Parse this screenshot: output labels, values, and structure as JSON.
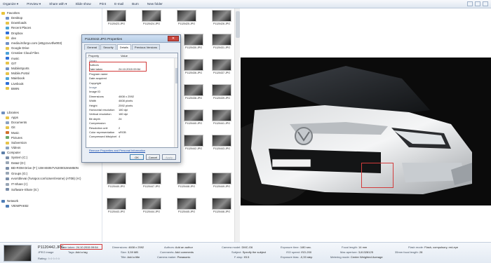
{
  "toolbar": {
    "organize": "Organize ▾",
    "preview": "Preview ▾",
    "share_with": "Share with ▾",
    "slide_show": "Slide show",
    "print": "Print",
    "email": "E-mail",
    "burn": "Burn",
    "new_folder": "New folder"
  },
  "nav": {
    "favorites_header": "Favorites",
    "favorites": [
      "Desktop",
      "Downloads",
      "Recent Places",
      "Dropbox",
      "dev",
      "media.itsforgo.com (eByp1vv4fw003)",
      "Google Drive",
      "Creative Cloud Files",
      "music",
      "GIT",
      "MobileSports",
      "Mobile.Portal",
      "Mainbook",
      "Livebook",
      "BWIN"
    ],
    "libraries_header": "Libraries",
    "libraries": [
      "Apps",
      "Documents",
      "Git",
      "Music",
      "Pictures",
      "Subversion",
      "Videos"
    ],
    "computer_header": "Computer",
    "computer": [
      "System (C:)",
      "Data2 (D:)",
      "BD-ROM Drive (F:) 108-8S057VS200019mM50N",
      "Groups (G:)",
      "evorsblevai (\\\\vsspor.com\\Users\\Home) (AT08) (H:)",
      "IT-Share (I:)",
      "Software-Share (S:)"
    ],
    "network_header": "Network",
    "network": [
      "VIEWPAK82"
    ]
  },
  "thumbnails": [
    "P1120423.JPG",
    "P1120424.JPG",
    "P1120425.JPG",
    "P1120426.JPG",
    "P1120430.JPG",
    "P1120431.JPG",
    "P1120436.JPG",
    "P1120437.JPG",
    "P1120438.JPG",
    "P1120439.JPG",
    "P1120440.JPG",
    "P1120441.JPG",
    "P1120442.JPG",
    "P1120443.JPG",
    "P1120440.JPG",
    "P1120447.JPG",
    "P1120448.JPG",
    "P1120449.JPG",
    "P1120443.JPG",
    "P1120444.JPG",
    "P1120445.JPG",
    "P1120446.JPG",
    "P1120447.JPG",
    "P1120448.JPG",
    "P1120449.JPG",
    "P1120450.JPG"
  ],
  "dialog": {
    "title": "P1120442.JPG Properties",
    "close": "✕",
    "tabs": [
      "General",
      "Security",
      "Details",
      "Previous Versions"
    ],
    "col_property": "Property",
    "col_value": "Value",
    "rows": [
      {
        "k": "Origin",
        "v": "",
        "section": true
      },
      {
        "k": "Authors",
        "v": ""
      },
      {
        "k": "Date taken",
        "v": "24.10.2015 09:54"
      },
      {
        "k": "Program name",
        "v": ""
      },
      {
        "k": "Date acquired",
        "v": ""
      },
      {
        "k": "Copyright",
        "v": ""
      },
      {
        "k": "Image",
        "v": "",
        "section": true
      },
      {
        "k": "Image ID",
        "v": ""
      },
      {
        "k": "Dimensions",
        "v": "4608 x 2592"
      },
      {
        "k": "Width",
        "v": "4608 pixels"
      },
      {
        "k": "Height",
        "v": "2592 pixels"
      },
      {
        "k": "Horizontal resolution",
        "v": "180 dpi"
      },
      {
        "k": "Vertical resolution",
        "v": "180 dpi"
      },
      {
        "k": "Bit depth",
        "v": "24"
      },
      {
        "k": "Compression",
        "v": ""
      },
      {
        "k": "Resolution unit",
        "v": "2"
      },
      {
        "k": "Color representation",
        "v": "sRGB"
      },
      {
        "k": "Compressed bits/pixel",
        "v": "4"
      }
    ],
    "link": "Remove Properties and Personal Information",
    "ok": "OK",
    "cancel": "Cancel",
    "apply": "Apply"
  },
  "details": {
    "name": "P1120442.JPG",
    "type": "JPEG image",
    "date_taken_label": "Date taken:",
    "date_taken": "24.10.2015 09:54",
    "tags_label": "Tags:",
    "tags": "Add a tag",
    "rating_label": "Rating:",
    "rating_stars": "☆☆☆☆☆",
    "dimensions_label": "Dimensions:",
    "dimensions": "4608 x 2592",
    "size_label": "Size:",
    "size": "3,59 MB",
    "title_label": "Title:",
    "title": "Add a title",
    "authors_label": "Authors:",
    "authors": "Add an author",
    "comments_label": "Comments:",
    "comments": "Add comments",
    "camera_maker_label": "Camera maker:",
    "camera_maker": "Panasonic",
    "camera_model_label": "Camera model:",
    "camera_model": "DMC-G6",
    "subject_label": "Subject:",
    "subject": "Specify the subject",
    "fstop_label": "F-stop:",
    "fstop": "f/3.5",
    "exposure_time_label": "Exposure time:",
    "exposure_time": "1/80 sec.",
    "iso_label": "ISO speed:",
    "iso": "ISO-200",
    "exposure_bias_label": "Exposure bias:",
    "exposure_bias": "-0,33 step",
    "focal_length_label": "Focal length:",
    "focal_length": "14 mm",
    "max_aperture_label": "Max aperture:",
    "max_aperture": "3,61328125",
    "metering_label": "Metering mode:",
    "metering": "Center Weighted Average",
    "flash_label": "Flash mode:",
    "flash": "Flash, compulsory, red-eye",
    "focal35_label": "35mm focal length:",
    "focal35": "28"
  },
  "colors": {
    "highlight_red": "#d23b3b",
    "dialog_close": "#c9473e",
    "toolbar_bg": "#dfe7f1"
  }
}
